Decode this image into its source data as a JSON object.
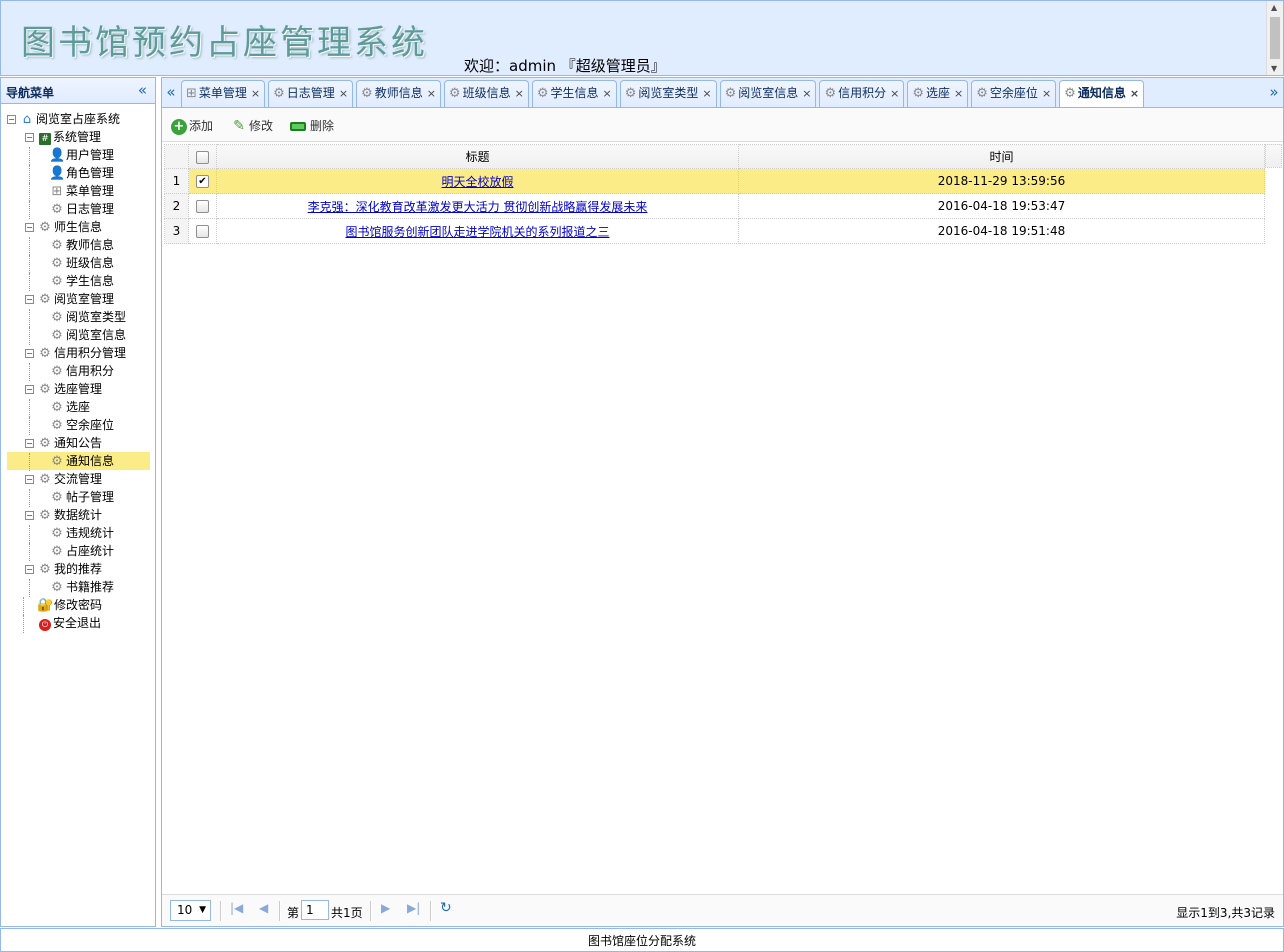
{
  "header": {
    "app_title": "图书馆预约占座管理系统",
    "welcome": "欢迎：admin 『超级管理员』"
  },
  "nav": {
    "title": "导航菜单",
    "collapse_icon": "double-chevron-left-icon",
    "root": "阅览室占座系统",
    "groups": [
      {
        "label": "系统管理",
        "items": [
          "用户管理",
          "角色管理",
          "菜单管理",
          "日志管理"
        ]
      },
      {
        "label": "师生信息",
        "items": [
          "教师信息",
          "班级信息",
          "学生信息"
        ]
      },
      {
        "label": "阅览室管理",
        "items": [
          "阅览室类型",
          "阅览室信息"
        ]
      },
      {
        "label": "信用积分管理",
        "items": [
          "信用积分"
        ]
      },
      {
        "label": "选座管理",
        "items": [
          "选座",
          "空余座位"
        ]
      },
      {
        "label": "通知公告",
        "items": [
          "通知信息"
        ]
      },
      {
        "label": "交流管理",
        "items": [
          "帖子管理"
        ]
      },
      {
        "label": "数据统计",
        "items": [
          "违规统计",
          "占座统计"
        ]
      },
      {
        "label": "我的推荐",
        "items": [
          "书籍推荐"
        ]
      }
    ],
    "extra": [
      "修改密码",
      "安全退出"
    ],
    "selected": "通知信息"
  },
  "tabs": [
    {
      "label": "菜单管理",
      "active": false
    },
    {
      "label": "日志管理",
      "active": false
    },
    {
      "label": "教师信息",
      "active": false
    },
    {
      "label": "班级信息",
      "active": false
    },
    {
      "label": "学生信息",
      "active": false
    },
    {
      "label": "阅览室类型",
      "active": false
    },
    {
      "label": "阅览室信息",
      "active": false
    },
    {
      "label": "信用积分",
      "active": false
    },
    {
      "label": "选座",
      "active": false
    },
    {
      "label": "空余座位",
      "active": false
    },
    {
      "label": "通知信息",
      "active": true
    }
  ],
  "toolbar": {
    "add_label": "添加",
    "edit_label": "修改",
    "delete_label": "删除"
  },
  "grid": {
    "columns": [
      "标题",
      "时间"
    ],
    "rows": [
      {
        "num": "1",
        "checked": true,
        "title": "明天全校放假",
        "time": "2018-11-29 13:59:56"
      },
      {
        "num": "2",
        "checked": false,
        "title": "李克强：深化教育改革激发更大活力 贯彻创新战略赢得发展未来",
        "time": "2016-04-18 19:53:47"
      },
      {
        "num": "3",
        "checked": false,
        "title": "图书馆服务创新团队走进学院机关的系列报道之三",
        "time": "2016-04-18 19:51:48"
      }
    ]
  },
  "pager": {
    "page_size": "10",
    "page_prefix": "第",
    "page_number": "1",
    "page_suffix": "共1页",
    "info": "显示1到3,共3记录"
  },
  "footer": {
    "text": "图书馆座位分配系统"
  }
}
